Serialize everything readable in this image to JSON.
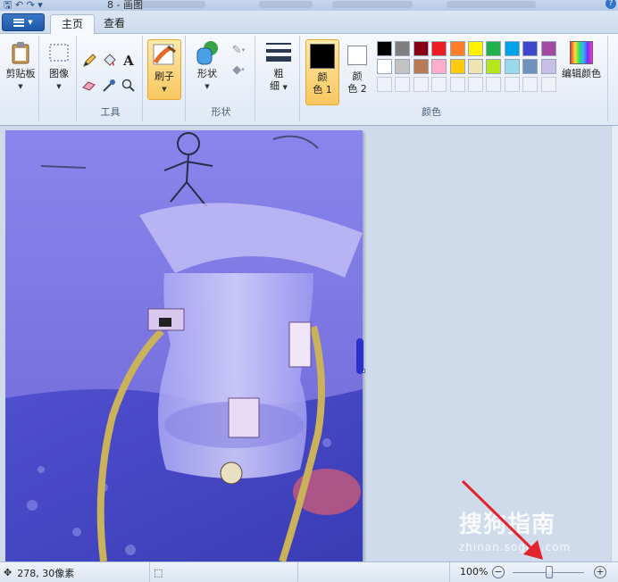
{
  "window": {
    "title": "8 - 画图",
    "help_icon": "help-icon"
  },
  "tabs": {
    "file_menu": "file-menu-icon",
    "home": "主页",
    "view": "查看"
  },
  "ribbon": {
    "clipboard": {
      "label": "剪贴板",
      "icon": "clipboard-icon"
    },
    "image": {
      "label": "图像",
      "icon": "select-icon"
    },
    "tools": {
      "group_label": "工具",
      "items": [
        "pencil-icon",
        "fill-icon",
        "text-icon",
        "eraser-icon",
        "color-picker-icon",
        "magnifier-icon"
      ],
      "text_glyph": "A"
    },
    "brushes": {
      "label": "刷子",
      "icon": "brush-icon"
    },
    "shapes": {
      "label": "形状",
      "group_label": "形状",
      "icon": "shapes-icon"
    },
    "size": {
      "label_line1": "粗",
      "label_line2": "细"
    },
    "color1": {
      "label_line1": "颜",
      "label_line2": "色 1",
      "value": "#000000"
    },
    "color2": {
      "label_line1": "颜",
      "label_line2": "色 2",
      "value": "#ffffff"
    },
    "colors_group_label": "颜色",
    "edit_colors": {
      "label": "编辑颜色",
      "icon": "color-wheel-icon"
    },
    "palette_row1": [
      "#000000",
      "#7f7f7f",
      "#880015",
      "#ed1c24",
      "#ff7f27",
      "#fff200",
      "#22b14c",
      "#00a2e8",
      "#3f48cc",
      "#a349a4"
    ],
    "palette_row2": [
      "#ffffff",
      "#c3c3c3",
      "#b97a57",
      "#ffaec9",
      "#ffc90e",
      "#efe4b0",
      "#b5e61d",
      "#99d9ea",
      "#7092be",
      "#c8bfe7"
    ],
    "palette_row3_empty": 10
  },
  "watermark": {
    "brand": "搜狗指南",
    "url": "zhinan.sogou.com"
  },
  "statusbar": {
    "cursor_pos": "278, 30像素",
    "zoom_level": "100%",
    "zoom_out": "−",
    "zoom_in": "+"
  }
}
